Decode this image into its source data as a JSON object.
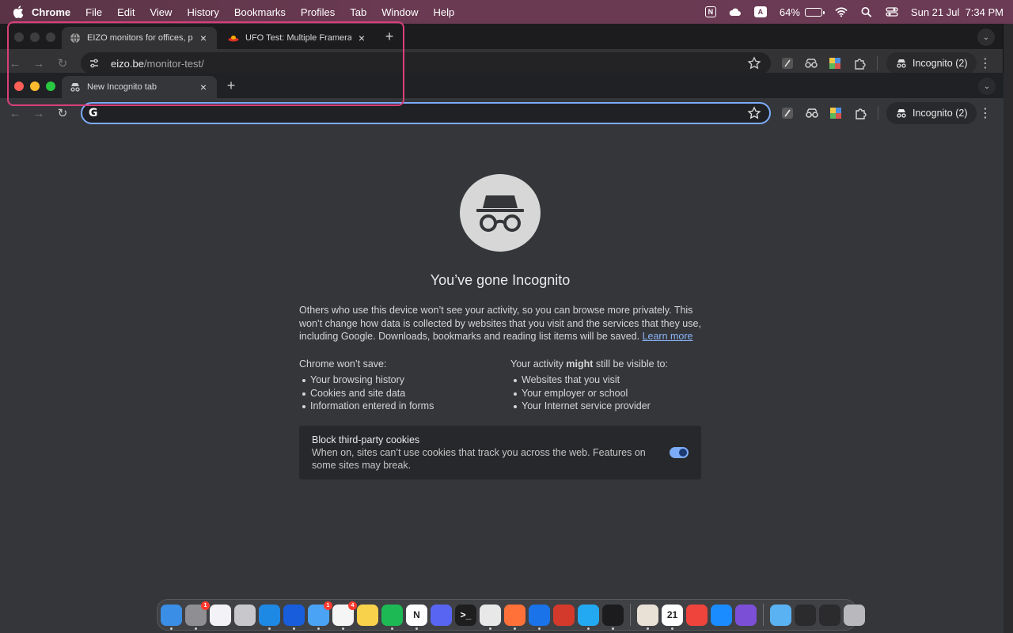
{
  "menubar": {
    "app_name": "Chrome",
    "items": [
      "File",
      "Edit",
      "View",
      "History",
      "Bookmarks",
      "Profiles",
      "Tab",
      "Window",
      "Help"
    ],
    "battery_percent": "64%",
    "battery_level": 0.64,
    "datetime": "Sun 21 Jul  7:34 PM",
    "status_n": "N",
    "status_a": "A"
  },
  "back_window": {
    "tabs": [
      {
        "title": "EIZO monitors for offices, photo",
        "active": true
      },
      {
        "title": "UFO Test: Multiple Framerates",
        "active": false
      }
    ],
    "url_host": "eizo.be",
    "url_path": "/monitor-test/",
    "profile_label": "Incognito (2)"
  },
  "front_window": {
    "tabs": [
      {
        "title": "New Incognito tab",
        "active": true
      }
    ],
    "omnibox_value": "",
    "omnibox_logo": "G",
    "profile_label": "Incognito (2)"
  },
  "incognito_page": {
    "headline": "You’ve gone Incognito",
    "description": "Others who use this device won’t see your activity, so you can browse more privately. This won’t change how data is collected by websites that you visit and the services that they use, including Google. Downloads, bookmarks and reading list items will be saved.",
    "learn_more": "Learn more",
    "wont_save_title": "Chrome won’t save:",
    "wont_save_items": [
      "Your browsing history",
      "Cookies and site data",
      "Information entered in forms"
    ],
    "visible_title_pre": "Your activity ",
    "visible_title_bold": "might",
    "visible_title_post": " still be visible to:",
    "visible_items": [
      "Websites that you visit",
      "Your employer or school",
      "Your Internet service provider"
    ],
    "cookie_title": "Block third-party cookies",
    "cookie_desc": "When on, sites can’t use cookies that track you across the web. Features on some sites may break.",
    "cookie_toggle_on": true
  },
  "dock": {
    "apps": [
      {
        "name": "finder",
        "color": "#3a8ee6",
        "label": "",
        "badge": "",
        "running": true
      },
      {
        "name": "system-settings",
        "color": "#8e8e93",
        "label": "",
        "badge": "1",
        "running": true
      },
      {
        "name": "freeform",
        "color": "#f2f2f7",
        "label": "",
        "badge": "",
        "running": false
      },
      {
        "name": "launchpad",
        "color": "#c7c7cc",
        "label": "",
        "badge": "",
        "running": false
      },
      {
        "name": "safari",
        "color": "#1e88e5",
        "label": "",
        "badge": "",
        "running": true
      },
      {
        "name": "bitwarden",
        "color": "#175ddc",
        "label": "",
        "badge": "",
        "running": true
      },
      {
        "name": "mail",
        "color": "#4aa3f5",
        "label": "",
        "badge": "1",
        "running": true
      },
      {
        "name": "reminders",
        "color": "#f5f5f5",
        "label": "",
        "badge": "4",
        "running": true
      },
      {
        "name": "notes",
        "color": "#f8d24a",
        "label": "",
        "badge": "",
        "running": false
      },
      {
        "name": "spotify",
        "color": "#1db954",
        "label": "",
        "badge": "",
        "running": true
      },
      {
        "name": "notion",
        "color": "#ffffff",
        "label": "N",
        "badge": "",
        "running": true
      },
      {
        "name": "discord",
        "color": "#5865f2",
        "label": "",
        "badge": "",
        "running": false
      },
      {
        "name": "terminal",
        "color": "#1e1e1e",
        "label": ">_",
        "badge": "",
        "running": false
      },
      {
        "name": "chrome",
        "color": "#e8e8e8",
        "label": "",
        "badge": "",
        "running": true
      },
      {
        "name": "firefox",
        "color": "#ff7139",
        "label": "",
        "badge": "",
        "running": true
      },
      {
        "name": "maps-pin",
        "color": "#1a73e8",
        "label": "",
        "badge": "",
        "running": true
      },
      {
        "name": "database",
        "color": "#d33a2c",
        "label": "",
        "badge": "",
        "running": false
      },
      {
        "name": "vscode",
        "color": "#23a9f2",
        "label": "",
        "badge": "",
        "running": true
      },
      {
        "name": "activity-monitor",
        "color": "#1c1c1e",
        "label": "",
        "badge": "",
        "running": true
      },
      {
        "name": "ramen",
        "color": "#e9e0d6",
        "label": "",
        "badge": "",
        "running": true
      },
      {
        "name": "calendar",
        "color": "#ffffff",
        "label": "21",
        "badge": "",
        "running": true
      },
      {
        "name": "anydesk",
        "color": "#ef443b",
        "label": "",
        "badge": "",
        "running": false
      },
      {
        "name": "app-store",
        "color": "#1a8cff",
        "label": "",
        "badge": "",
        "running": false
      },
      {
        "name": "imovie",
        "color": "#7b4fd6",
        "label": "",
        "badge": "",
        "running": false
      },
      {
        "name": "folder",
        "color": "#5ab2f2",
        "label": "",
        "badge": "",
        "running": false
      },
      {
        "name": "window-preview-1",
        "color": "#2b2b2d",
        "label": "",
        "badge": "",
        "running": false
      },
      {
        "name": "window-preview-2",
        "color": "#2b2b2d",
        "label": "",
        "badge": "",
        "running": false
      },
      {
        "name": "trash",
        "color": "#b8b8bd",
        "label": "",
        "badge": "",
        "running": false
      }
    ]
  },
  "colors": {
    "annotation": "#d8407a",
    "accent": "#7cacf8",
    "page_bg": "#35363a"
  }
}
